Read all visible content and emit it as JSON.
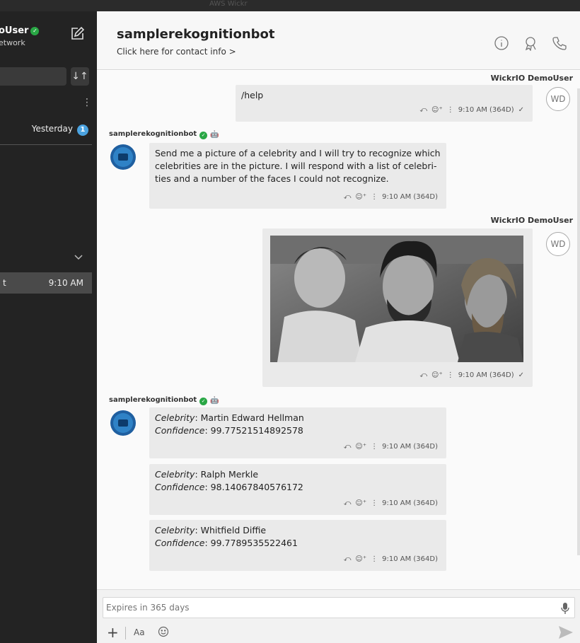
{
  "window": {
    "title": "AWS Wickr"
  },
  "sidebar": {
    "user_name": "oUser",
    "network": "etwork",
    "conversation_time": "Yesterday",
    "unread_count": "1",
    "active_item_text": "t",
    "active_item_time": "9:10 AM"
  },
  "header": {
    "title": "samplerekognitionbot",
    "subtitle": "Click here for contact info >"
  },
  "messages": [
    {
      "sender": "WickrIO DemoUser",
      "avatar": "WD",
      "text": "/help",
      "time": "9:10 AM (364D)",
      "check": "✓"
    },
    {
      "sender": "samplerekognitionbot",
      "text": "Send me a picture of a celebrity and I will try to recognize which celebrities are in the picture. I will respond with a list of celebri-ties and a number of the faces I could not recognize.",
      "time": "9:10 AM (364D)"
    },
    {
      "sender": "WickrIO DemoUser",
      "avatar": "WD",
      "time": "9:10 AM (364D)",
      "check": "✓"
    },
    {
      "sender": "samplerekognitionbot",
      "results": [
        {
          "celebrity_label": "Celebrity",
          "celebrity": ": Martin Edward Hellman",
          "confidence_label": "Confidence",
          "confidence": ": 99.77521514892578",
          "time": "9:10 AM (364D)"
        },
        {
          "celebrity_label": "Celebrity",
          "celebrity": ": Ralph Merkle",
          "confidence_label": "Confidence",
          "confidence": ": 98.14067840576172",
          "time": "9:10 AM (364D)"
        },
        {
          "celebrity_label": "Celebrity",
          "celebrity": ": Whitfield Diffie",
          "confidence_label": "Confidence",
          "confidence": ": 99.7789535522461",
          "time": "9:10 AM (364D)"
        }
      ]
    }
  ],
  "composer": {
    "placeholder": "Expires in 365 days",
    "format_label": "Aa"
  },
  "colors": {
    "sidebar_bg": "#232323",
    "accent_badge": "#4ba3e0",
    "verified_green": "#29a745",
    "bubble_bg": "#eaeaea"
  },
  "icons": [
    "compose-icon",
    "sort-icon",
    "more-icon",
    "chevron-down-icon",
    "info-icon",
    "badge-icon",
    "phone-icon",
    "reply-icon",
    "emoji-react-icon",
    "mic-icon",
    "plus-icon",
    "emoji-icon",
    "send-icon",
    "verified-icon",
    "bot-icon"
  ]
}
